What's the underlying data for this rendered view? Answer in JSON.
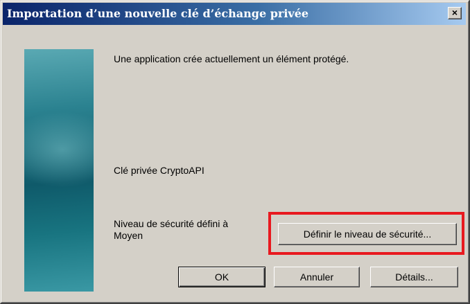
{
  "window": {
    "title": "Importation d’une nouvelle clé d’échange privée",
    "close_label": "×"
  },
  "body": {
    "message": "Une application crée actuellement un élément protégé.",
    "key_name": "Clé privée CryptoAPI",
    "security_level_line1": "Niveau de sécurité défini à",
    "security_level_line2": "Moyen"
  },
  "buttons": {
    "set_security_level": "Définir le niveau de sécurité...",
    "ok": "OK",
    "cancel": "Annuler",
    "details": "Détails..."
  },
  "colors": {
    "title_bar": "#0a246a",
    "dialog_face": "#d4d0c8",
    "highlight_box": "#e8191f",
    "banner": "#1a6b78"
  }
}
